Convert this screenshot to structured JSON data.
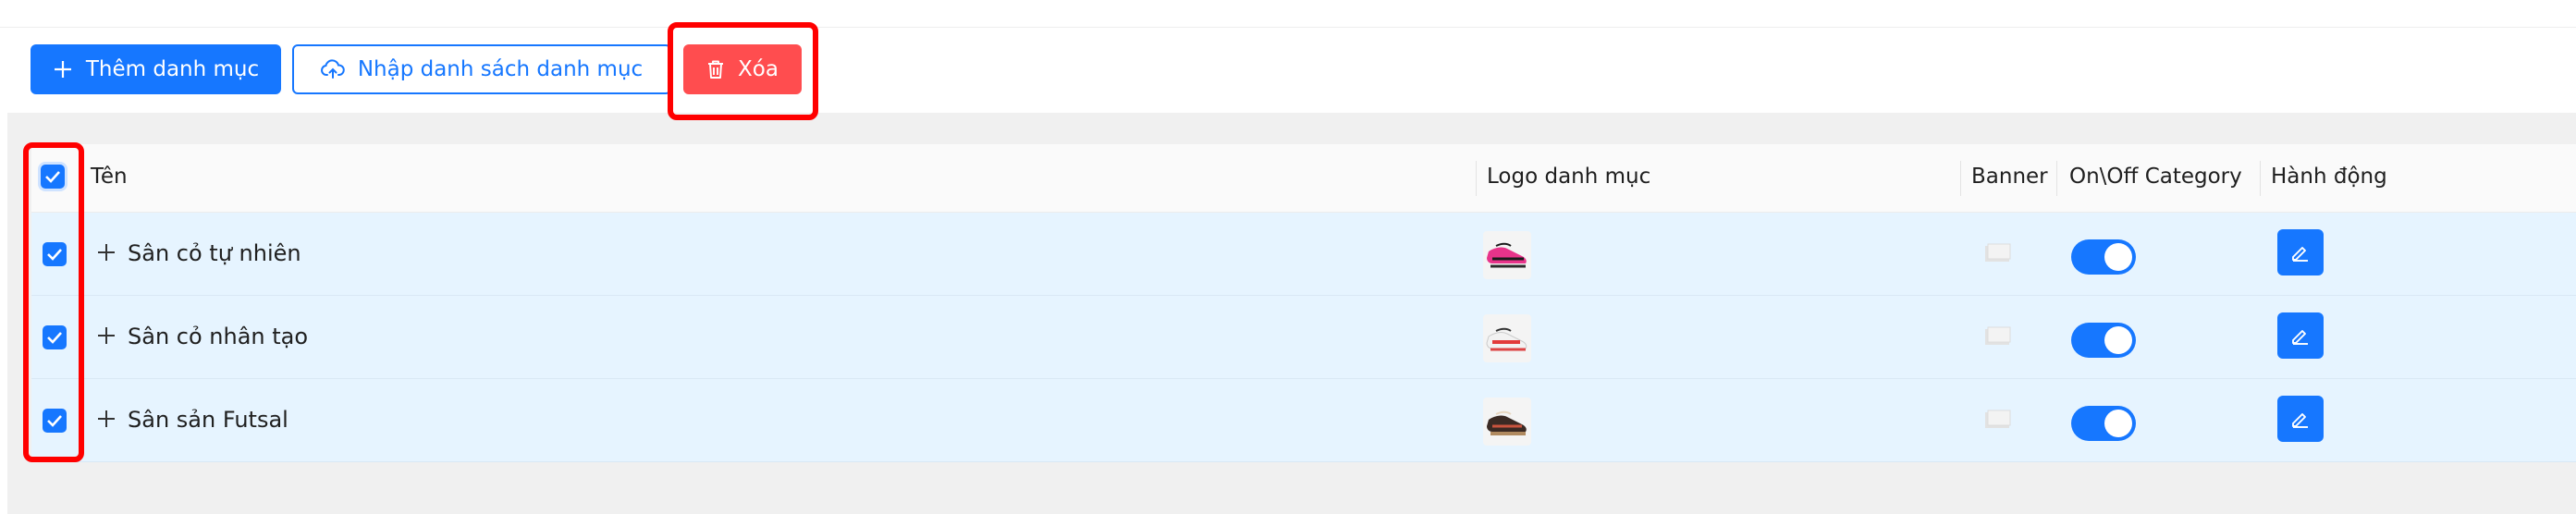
{
  "top_strip": {
    "text": ""
  },
  "toolbar": {
    "add_label": "Thêm danh mục",
    "import_label": "Nhập danh sách danh mục",
    "delete_label": "Xóa"
  },
  "table": {
    "columns": [
      "Tên",
      "Logo danh mục",
      "Banner",
      "On\\Off Category",
      "Hành động"
    ],
    "rows": [
      {
        "name": "Sân cỏ tự nhiên",
        "checked": true,
        "enabled": true
      },
      {
        "name": "Sân cỏ nhân tạo",
        "checked": true,
        "enabled": true
      },
      {
        "name": "Sân sản Futsal",
        "checked": true,
        "enabled": true
      }
    ],
    "select_all_checked": true
  },
  "colors": {
    "primary": "#1677ff",
    "danger": "#ff4d4f",
    "highlight": "#ff0000",
    "row_selected_bg": "#e6f4ff"
  },
  "icons": {
    "add": "plus-icon",
    "import": "cloud-upload-icon",
    "delete": "trash-icon",
    "edit": "pencil-icon",
    "expand": "plus-icon",
    "check": "check-icon"
  }
}
